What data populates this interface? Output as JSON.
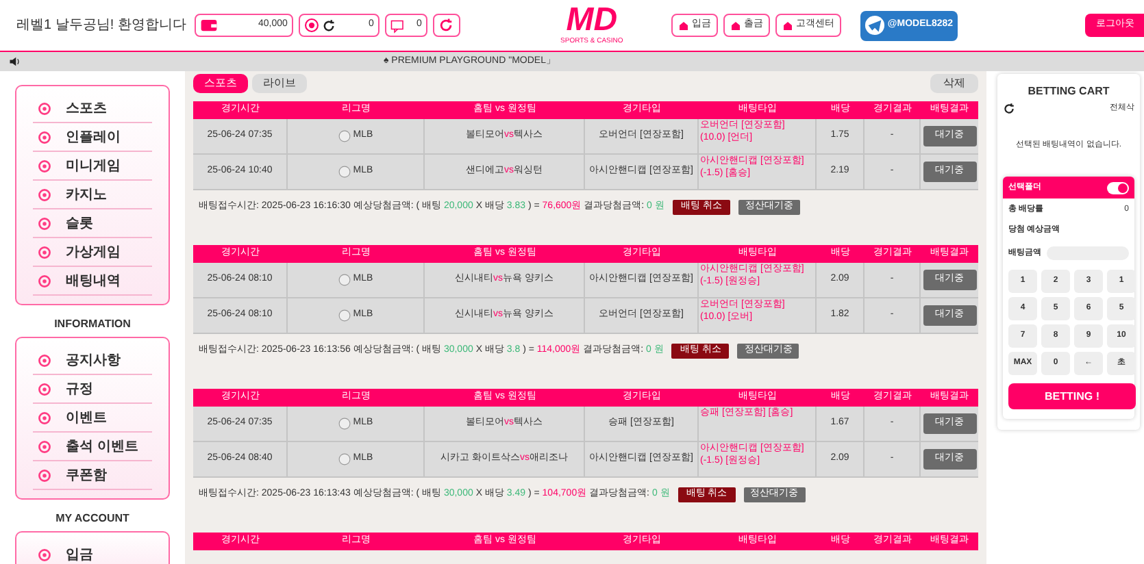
{
  "header": {
    "welcome": "레벨1 날두공님! 환영합니다",
    "wallet": "40,000",
    "points": "0",
    "messages": "0",
    "logo": "MD",
    "logo_sub": "SPORTS & CASINO",
    "buttons": [
      "입금",
      "출금",
      "고객센터"
    ],
    "telegram": "@MODEL8282",
    "logout": "로그아웃"
  },
  "ticker": "♠ PREMIUM PLAYGROUND \"MODEL」",
  "sidebar": {
    "menu": [
      "스포츠",
      "인플레이",
      "미니게임",
      "카지노",
      "슬롯",
      "가상게임",
      "배팅내역"
    ],
    "sections": [
      {
        "title": "INFORMATION",
        "items": [
          "공지사항",
          "규정",
          "이벤트",
          "출석 이벤트",
          "쿠폰함"
        ]
      },
      {
        "title": "MY ACCOUNT",
        "items": [
          "입금"
        ]
      }
    ]
  },
  "tabs": [
    {
      "label": "스포츠",
      "selected": true
    },
    {
      "label": "라이브",
      "selected": false
    }
  ],
  "delete_button": "삭제",
  "bets": [
    {
      "columns": [
        "경기시간",
        "리그명",
        "홈팀 vs 원정팀",
        "경기타입",
        "배팅타입",
        "배당",
        "경기결과",
        "배팅결과"
      ],
      "rows": [
        {
          "time": "25-06-24 07:35",
          "league": "MLB",
          "home": "볼티모어",
          "vs": "vs",
          "away": "텍사스",
          "game_type": "오버언더 [연장포함]",
          "bet_type": [
            "오버언더 [연장포함]",
            "(10.0) [언더]"
          ],
          "odds": "1.75",
          "result": "-",
          "status": "대기중"
        },
        {
          "time": "25-06-24 10:40",
          "league": "MLB",
          "home": "샌디에고",
          "vs": "vs",
          "away": "워싱턴",
          "game_type": "아시안핸디캡 [연장포함]",
          "bet_type": [
            "아시안핸디캡 [연장포함]",
            "(-1.5) [홈승]"
          ],
          "odds": "2.19",
          "result": "-",
          "status": "대기중"
        }
      ],
      "summary": {
        "received": "배팅접수시간: 2025-06-23 16:16:30",
        "expected_label": "예상당첨금액: ( 배팅",
        "stake": "20,000",
        "odds_label": "X 배당",
        "odds": "3.83",
        "equals": ") =",
        "payout": "76,600원",
        "result_label": "결과당첨금액:",
        "result": "0 원"
      },
      "cancel": "배팅 취소",
      "state": "정산대기중"
    },
    {
      "columns": [
        "경기시간",
        "리그명",
        "홈팀 vs 원정팀",
        "경기타입",
        "배팅타입",
        "배당",
        "경기결과",
        "배팅결과"
      ],
      "rows": [
        {
          "time": "25-06-24 08:10",
          "league": "MLB",
          "home": "신시내티",
          "vs": "vs",
          "away": "뉴욕 양키스",
          "game_type": "아시안핸디캡 [연장포함]",
          "bet_type": [
            "아시안핸디캡 [연장포함]",
            "(-1.5) [원정승]"
          ],
          "odds": "2.09",
          "result": "-",
          "status": "대기중"
        },
        {
          "time": "25-06-24 08:10",
          "league": "MLB",
          "home": "신시내티",
          "vs": "vs",
          "away": "뉴욕 양키스",
          "game_type": "오버언더 [연장포함]",
          "bet_type": [
            "오버언더 [연장포함]",
            "(10.0) [오버]"
          ],
          "odds": "1.82",
          "result": "-",
          "status": "대기중"
        }
      ],
      "summary": {
        "received": "배팅접수시간: 2025-06-23 16:13:56",
        "expected_label": "예상당첨금액: ( 배팅",
        "stake": "30,000",
        "odds_label": "X 배당",
        "odds": "3.8",
        "equals": ") =",
        "payout": "114,000원",
        "result_label": "결과당첨금액:",
        "result": "0 원"
      },
      "cancel": "배팅 취소",
      "state": "정산대기중"
    },
    {
      "columns": [
        "경기시간",
        "리그명",
        "홈팀 vs 원정팀",
        "경기타입",
        "배팅타입",
        "배당",
        "경기결과",
        "배팅결과"
      ],
      "rows": [
        {
          "time": "25-06-24 07:35",
          "league": "MLB",
          "home": "볼티모어",
          "vs": "vs",
          "away": "텍사스",
          "game_type": "승패 [연장포함]",
          "bet_type": [
            "승패 [연장포함] [홈승]"
          ],
          "odds": "1.67",
          "result": "-",
          "status": "대기중"
        },
        {
          "time": "25-06-24 08:40",
          "league": "MLB",
          "home": "시카고 화이트삭스",
          "vs": "vs",
          "away": "애리조나",
          "game_type": "아시안핸디캡 [연장포함]",
          "bet_type": [
            "아시안핸디캡 [연장포함]",
            "(-1.5) [원정승]"
          ],
          "odds": "2.09",
          "result": "-",
          "status": "대기중"
        }
      ],
      "summary": {
        "received": "배팅접수시간: 2025-06-23 16:13:43",
        "expected_label": "예상당첨금액: ( 배팅",
        "stake": "30,000",
        "odds_label": "X 배당",
        "odds": "3.49",
        "equals": ") =",
        "payout": "104,700원",
        "result_label": "결과당첨금액:",
        "result": "0 원"
      },
      "cancel": "배팅 취소",
      "state": "정산대기중"
    },
    {
      "columns": [
        "경기시간",
        "리그명",
        "홈팀 vs 원정팀",
        "경기타입",
        "배팅타입",
        "배당",
        "경기결과",
        "배팅결과"
      ]
    }
  ],
  "cart": {
    "title": "BETTING CART",
    "clear": "전체삭",
    "empty": "선택된 배팅내역이 없습니다.",
    "folder_label": "선택폴더",
    "folder_toggle_on": true,
    "total_odds_label": "총 배당률",
    "total_odds": "0",
    "expected_label": "당첨 예상금액",
    "amount_label": "배팅금액",
    "keys": [
      "1",
      "2",
      "3",
      "1",
      "4",
      "5",
      "6",
      "5",
      "7",
      "8",
      "9",
      "10",
      "MAX",
      "0",
      "←",
      "초"
    ],
    "submit": "BETTING !"
  }
}
